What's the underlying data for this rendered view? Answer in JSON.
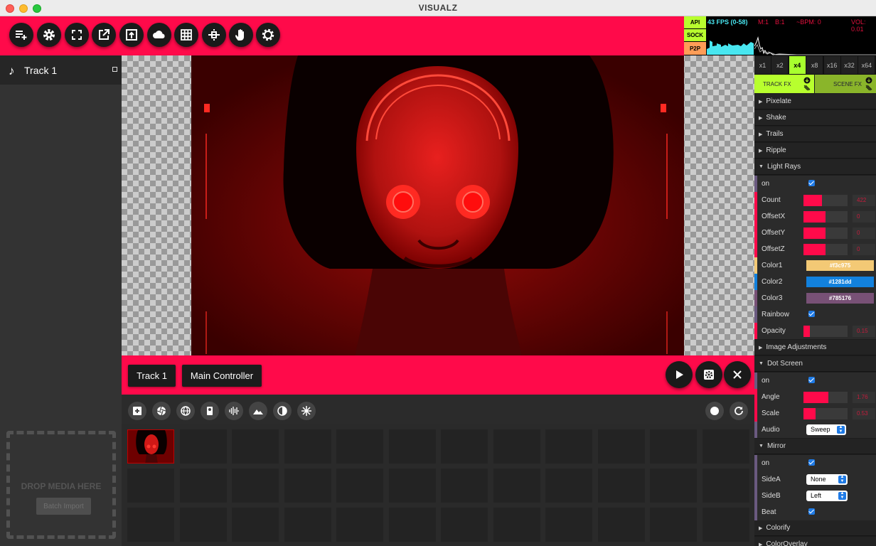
{
  "window": {
    "title": "VISUALZ"
  },
  "toolbar": {
    "buttons": [
      "add-playlist-icon",
      "settings-icon",
      "fullscreen-icon",
      "external-window-icon",
      "upload-icon",
      "cloud-icon",
      "grid-icon",
      "split-icon",
      "hand-icon",
      "gear-cog-icon"
    ]
  },
  "status": {
    "api": "API",
    "sock": "SOCK",
    "p2p": "P2P",
    "fps": "43 FPS (0-58)",
    "m": "M:1",
    "b": "B:1",
    "bpm": "~BPM: 0",
    "vol": "VOL: 0.01",
    "colors": {
      "api": "#b8ff2e",
      "sock": "#b8ff2e",
      "p2p": "#ff9d57"
    }
  },
  "sidebar": {
    "track_label": "Track 1",
    "drop_text": "DROP MEDIA HERE",
    "batch_label": "Batch Import"
  },
  "controls": {
    "track_tab": "Track 1",
    "main_tab": "Main Controller"
  },
  "multipliers": [
    "x1",
    "x2",
    "x4",
    "x8",
    "x16",
    "x32",
    "x64"
  ],
  "active_multiplier": "x4",
  "fx_tabs": {
    "track": "TRACK FX",
    "scene": "SCENE FX"
  },
  "sections": {
    "pixelate": "Pixelate",
    "shake": "Shake",
    "trails": "Trails",
    "ripple": "Ripple",
    "light_rays": "Light Rays",
    "image_adjustments": "Image Adjustments",
    "dot_screen": "Dot Screen",
    "mirror": "Mirror",
    "colorify": "Colorify",
    "coloroverlay": "ColorOverlay"
  },
  "light_rays": {
    "on": "on",
    "count": {
      "label": "Count",
      "value": "422",
      "fraction": 0.42
    },
    "offsetx": {
      "label": "OffsetX",
      "value": "0",
      "fraction": 0.5
    },
    "offsety": {
      "label": "OffsetY",
      "value": "0",
      "fraction": 0.5
    },
    "offsetz": {
      "label": "OffsetZ",
      "value": "0",
      "fraction": 0.5
    },
    "color1": {
      "label": "Color1",
      "value": "#f3c975"
    },
    "color2": {
      "label": "Color2",
      "value": "#1281dd"
    },
    "color3": {
      "label": "Color3",
      "value": "#785176"
    },
    "rainbow": "Rainbow",
    "opacity": {
      "label": "Opacity",
      "value": "0.15",
      "fraction": 0.15
    }
  },
  "dot_screen": {
    "on": "on",
    "angle": {
      "label": "Angle",
      "value": "1.76",
      "fraction": 0.56
    },
    "scale": {
      "label": "Scale",
      "value": "0.53",
      "fraction": 0.27
    },
    "audio": {
      "label": "Audio",
      "value": "Sweep"
    }
  },
  "mirror": {
    "on": "on",
    "sidea": {
      "label": "SideA",
      "value": "None"
    },
    "sideb": {
      "label": "SideB",
      "value": "Left"
    },
    "beat": "Beat"
  },
  "accent": "#ff0a4a"
}
